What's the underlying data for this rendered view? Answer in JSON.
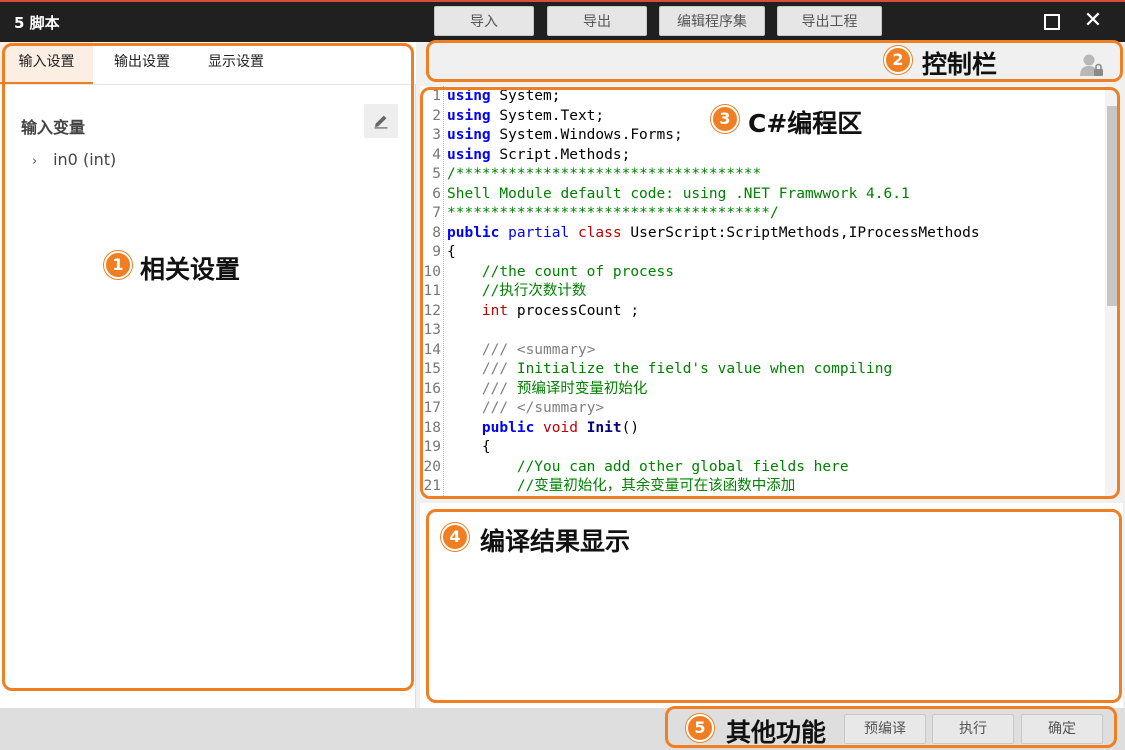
{
  "window": {
    "title": "5 脚本",
    "maximize_icon": "maximize-icon",
    "close_icon": "close-icon",
    "close_glyph": "✕"
  },
  "left_panel": {
    "tabs": [
      {
        "label": "输入设置"
      },
      {
        "label": "输出设置"
      },
      {
        "label": "显示设置"
      }
    ],
    "active_tab": 0,
    "section_title": "输入变量",
    "edit_icon": "pencil-icon",
    "tree_items": [
      {
        "chevron": "›",
        "label": "in0 (int)"
      }
    ]
  },
  "toolbar": {
    "buttons": [
      {
        "label": "导入"
      },
      {
        "label": "导出"
      },
      {
        "label": "编辑程序集"
      },
      {
        "label": "导出工程"
      }
    ],
    "user_icon": "user-lock-icon"
  },
  "editor": {
    "lines": [
      {
        "n": "1",
        "parts": [
          [
            "kw",
            "using"
          ],
          [
            "",
            "System;"
          ]
        ]
      },
      {
        "n": "2",
        "parts": [
          [
            "kw",
            "using"
          ],
          [
            "",
            "System.Text;"
          ]
        ]
      },
      {
        "n": "3",
        "parts": [
          [
            "kw",
            "using"
          ],
          [
            "",
            "System.Windows.Forms;"
          ]
        ]
      },
      {
        "n": "4",
        "parts": [
          [
            "kw",
            "using"
          ],
          [
            "",
            "Script.Methods;"
          ]
        ]
      },
      {
        "n": "5",
        "parts": [
          [
            "cm",
            "/***********************************"
          ]
        ]
      },
      {
        "n": "6",
        "parts": [
          [
            "cm",
            "Shell Module default code: using .NET Framwwork 4.6.1"
          ]
        ]
      },
      {
        "n": "7",
        "parts": [
          [
            "cm",
            "*************************************/"
          ]
        ]
      },
      {
        "n": "8",
        "parts": [
          [
            "kw",
            "public"
          ],
          [
            "kw2",
            " partial"
          ],
          [
            "kwr",
            " class"
          ],
          [
            "",
            " UserScript:ScriptMethods,IProcessMethods"
          ]
        ]
      },
      {
        "n": "9",
        "parts": [
          [
            "",
            "{"
          ]
        ]
      },
      {
        "n": "10",
        "parts": [
          [
            "cm",
            "    //the count of process"
          ]
        ]
      },
      {
        "n": "11",
        "parts": [
          [
            "cm",
            "    //执行次数计数"
          ]
        ]
      },
      {
        "n": "12",
        "parts": [
          [
            "",
            "    "
          ],
          [
            "kwr",
            "int"
          ],
          [
            "",
            " processCount ;"
          ]
        ]
      },
      {
        "n": "13",
        "parts": [
          [
            "",
            ""
          ]
        ]
      },
      {
        "n": "14",
        "parts": [
          [
            "cmg",
            "    /// <"
          ],
          [
            "cmg",
            "summary"
          ],
          [
            "cmg",
            ">"
          ]
        ]
      },
      {
        "n": "15",
        "parts": [
          [
            "cmg",
            "    ///"
          ],
          [
            "cm",
            " Initialize the field's value when compiling"
          ]
        ]
      },
      {
        "n": "16",
        "parts": [
          [
            "cmg",
            "    ///"
          ],
          [
            "cm",
            " 预编译时变量初始化"
          ]
        ]
      },
      {
        "n": "17",
        "parts": [
          [
            "cmg",
            "    /// </"
          ],
          [
            "cmg",
            "summary"
          ],
          [
            "cmg",
            ">"
          ]
        ]
      },
      {
        "n": "18",
        "parts": [
          [
            "",
            "    "
          ],
          [
            "kw",
            "public"
          ],
          [
            "kwr",
            " void"
          ],
          [
            "fn",
            " Init"
          ],
          [
            "",
            "()"
          ]
        ]
      },
      {
        "n": "19",
        "parts": [
          [
            "",
            "    {"
          ]
        ]
      },
      {
        "n": "20",
        "parts": [
          [
            "cm",
            "        //You can add other global fields here"
          ]
        ]
      },
      {
        "n": "21",
        "parts": [
          [
            "cm",
            "        //变量初始化，其余变量可在该函数中添加"
          ]
        ]
      }
    ]
  },
  "bottom_bar": {
    "buttons": [
      {
        "label": "预编译"
      },
      {
        "label": "执行"
      },
      {
        "label": "确定"
      }
    ]
  },
  "annotations": [
    {
      "num": "1",
      "label": "相关设置"
    },
    {
      "num": "2",
      "label": "控制栏"
    },
    {
      "num": "3",
      "label": "C#编程区"
    },
    {
      "num": "4",
      "label": "编译结果显示"
    },
    {
      "num": "5",
      "label": "其他功能"
    }
  ],
  "colors": {
    "accent": "#f07f23",
    "titlebar": "#202020",
    "keyword": "#0000ff",
    "type": "#c00000",
    "comment": "#008000"
  }
}
